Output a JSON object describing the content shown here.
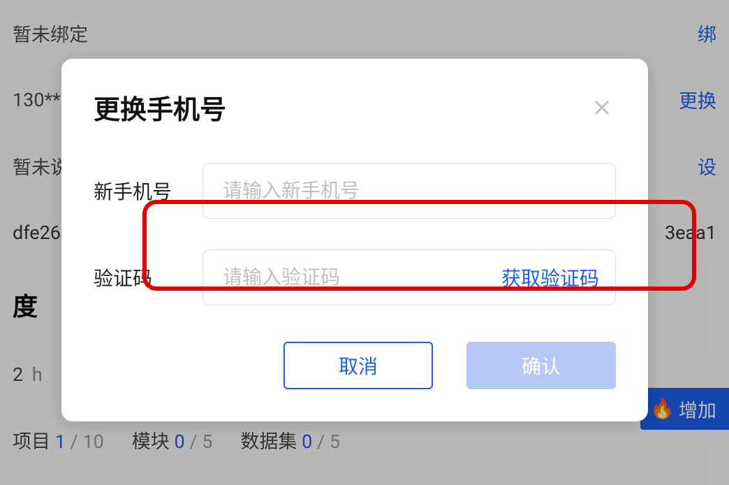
{
  "background": {
    "rows": [
      {
        "left": "暂未绑定",
        "right": "绑"
      },
      {
        "left": "130**",
        "right": "更换"
      },
      {
        "left": "暂未说",
        "right": "设"
      },
      {
        "left": "dfe26",
        "rightTail": "3eaa1"
      }
    ],
    "sectionTitle": "度",
    "quota": {
      "value": "2",
      "unit": "h"
    },
    "counts": {
      "project": {
        "label": "项目",
        "num": "1",
        "den": "10"
      },
      "module": {
        "label": "模块",
        "num": "0",
        "den": "5"
      },
      "dataset": {
        "label": "数据集",
        "num": "0",
        "den": "5"
      }
    },
    "addButton": {
      "icon": "fire-icon",
      "label": "增加"
    }
  },
  "modal": {
    "title": "更换手机号",
    "close": "close",
    "phone": {
      "label": "新手机号",
      "placeholder": "请输入新手机号",
      "value": ""
    },
    "code": {
      "label": "验证码",
      "placeholder": "请输入验证码",
      "value": "",
      "getCodeLabel": "获取验证码"
    },
    "actions": {
      "cancel": "取消",
      "confirm": "确认"
    }
  }
}
